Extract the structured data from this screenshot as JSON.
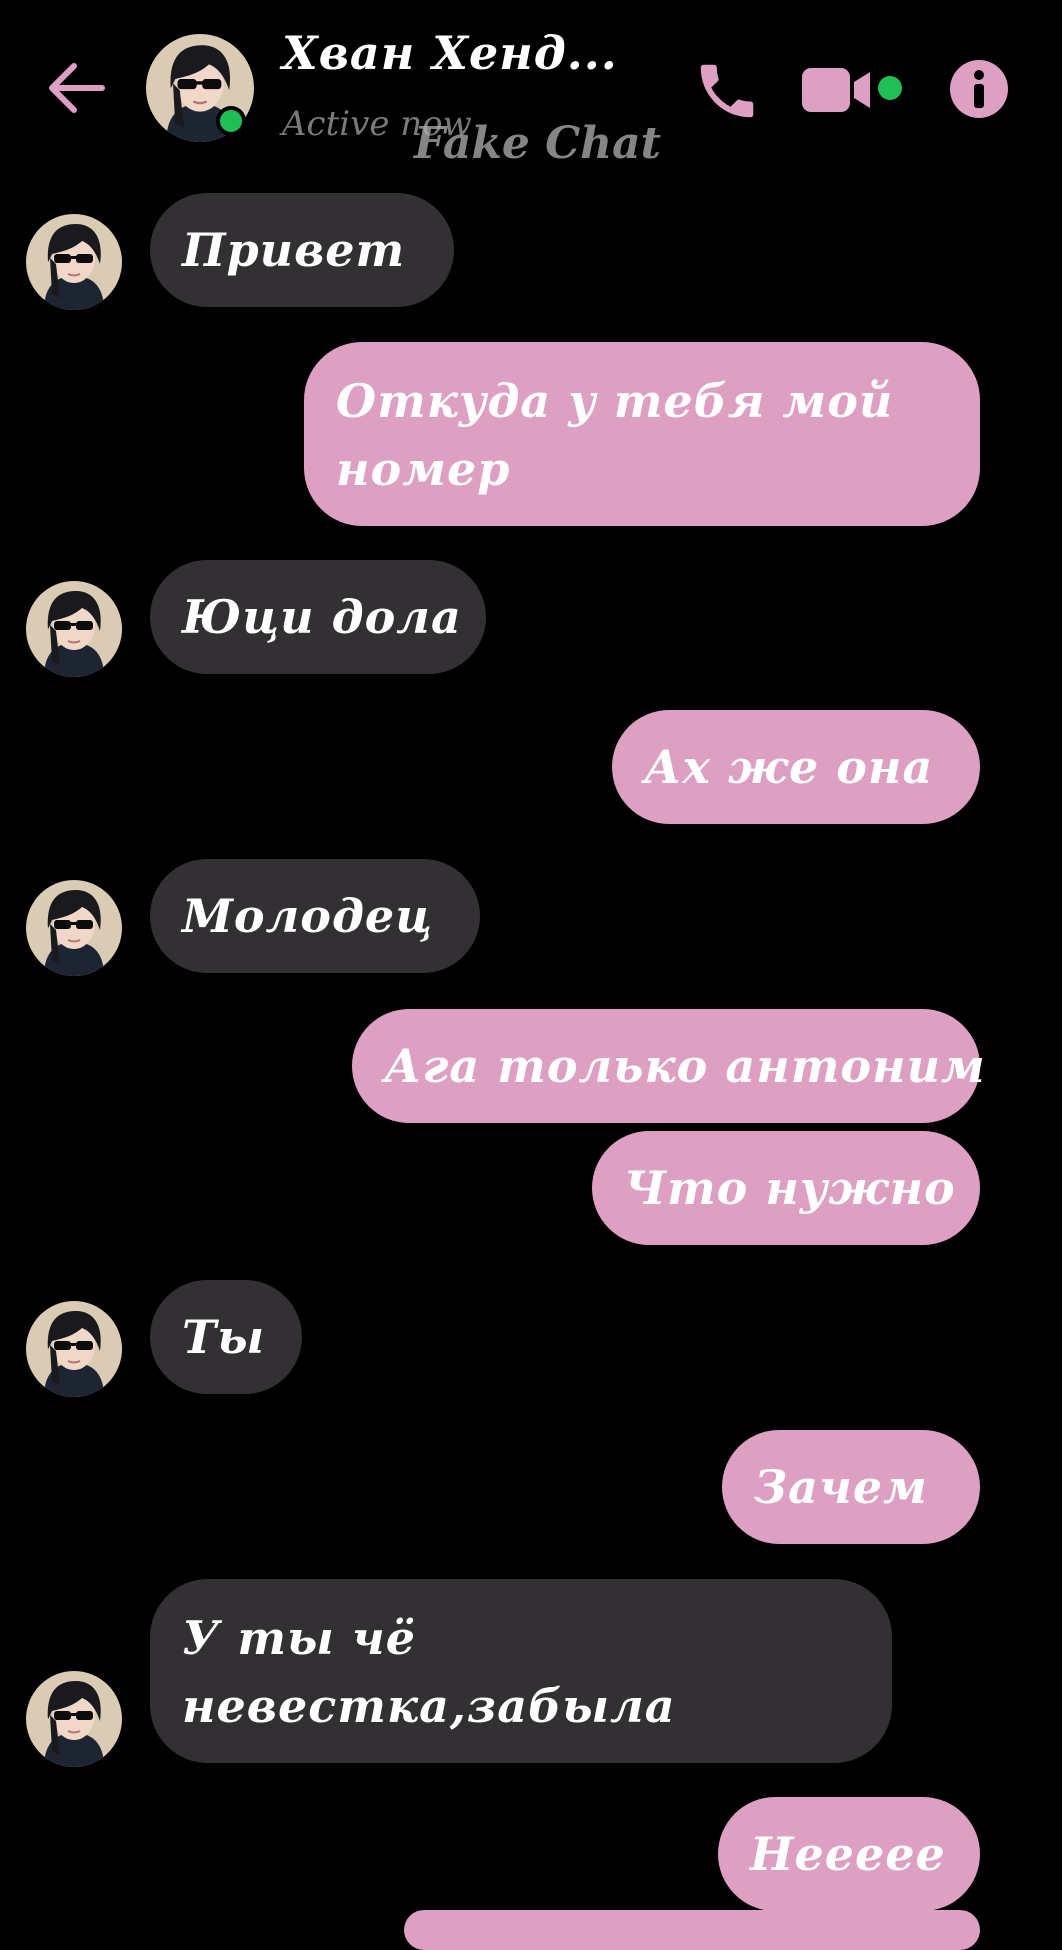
{
  "header": {
    "contact_name": "Хван Хенд...",
    "status": "Active now",
    "watermark": "Fake Chat"
  },
  "icons": {
    "back": "arrow-left-icon",
    "call": "phone-icon",
    "video": "video-camera-icon",
    "info": "info-icon",
    "avatar": "avatar-photo"
  },
  "colors": {
    "accent": "#dd9fc2",
    "outgoing_bubble": "#dd9fc2",
    "incoming_bubble": "#333033",
    "online": "#1fbf56",
    "background": "#000000"
  },
  "messages": [
    {
      "from": "them",
      "text": "Привет"
    },
    {
      "from": "me",
      "text": "Откуда у тебя мой номер"
    },
    {
      "from": "them",
      "text": "Юци дола"
    },
    {
      "from": "me",
      "text": "Ах же она"
    },
    {
      "from": "them",
      "text": "Молодец"
    },
    {
      "from": "me",
      "text": "Ага только антоним"
    },
    {
      "from": "me",
      "text": "Что нужно"
    },
    {
      "from": "them",
      "text": "Ты"
    },
    {
      "from": "me",
      "text": "Зачем"
    },
    {
      "from": "them",
      "text": "У ты чё невестка,забыла"
    },
    {
      "from": "me",
      "text": "Нееееe"
    }
  ]
}
